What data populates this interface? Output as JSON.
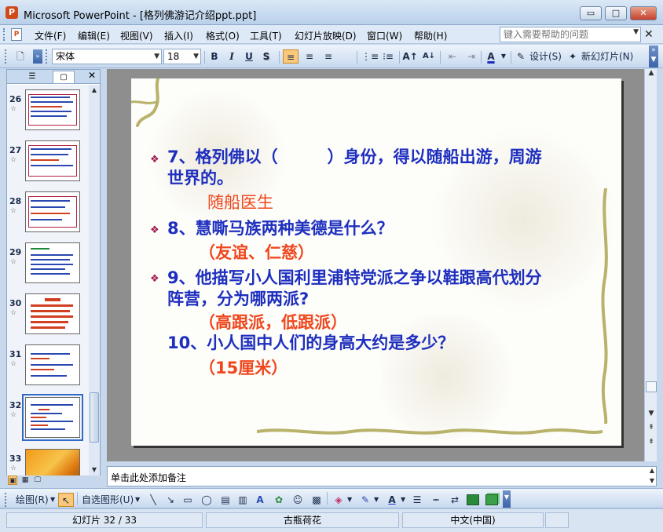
{
  "window": {
    "title": "Microsoft PowerPoint - [格列佛游记介绍ppt.ppt]",
    "app_icon": "powerpoint-icon",
    "buttons": {
      "minimize": "▭",
      "maximize": "□",
      "close": "✕"
    }
  },
  "menu": {
    "items": [
      "文件(F)",
      "编辑(E)",
      "视图(V)",
      "插入(I)",
      "格式(O)",
      "工具(T)",
      "幻灯片放映(D)",
      "窗口(W)",
      "帮助(H)"
    ],
    "help_placeholder": "键入需要帮助的问题"
  },
  "format_toolbar": {
    "font_name": "宋体",
    "font_size": "18",
    "bold": "B",
    "italic": "I",
    "underline": "U",
    "shadow": "S",
    "design_label": "设计(S)",
    "new_slide_label": "新幻灯片(N)"
  },
  "slides_pane": {
    "thumbnails": [
      {
        "num": "26",
        "star": "☆"
      },
      {
        "num": "27",
        "star": "☆"
      },
      {
        "num": "28",
        "star": "☆"
      },
      {
        "num": "29",
        "star": "☆"
      },
      {
        "num": "30",
        "star": "☆"
      },
      {
        "num": "31",
        "star": "☆"
      },
      {
        "num": "32",
        "star": "☆"
      },
      {
        "num": "33",
        "star": "☆"
      }
    ],
    "selected": "32"
  },
  "slide": {
    "q7_line1": "7、格列佛以（　　　）身份，得以随船出游，周游",
    "q7_line2": "世界的。",
    "a7": "随船医生",
    "q8": "8、慧嘶马族两种美德是什么？",
    "a8": "（友谊、仁慈）",
    "q9_line1": "9、他描写小人国利里浦特党派之争以鞋跟高代划分",
    "q9_line2": "阵营，分为哪两派?",
    "a9": "（高跟派，低跟派）",
    "q10": "10、小人国中人们的身高大约是多少？",
    "a10_open": "（",
    "a10_num": "15",
    "a10_close": "厘米）",
    "bullet": "❖"
  },
  "notes": {
    "placeholder": "单击此处添加备注"
  },
  "draw_toolbar": {
    "draw_label": "绘图(R)",
    "autoshape_label": "自选图形(U)"
  },
  "status": {
    "slide_info": "幻灯片 32 / 33",
    "design": "古瓶荷花",
    "language": "中文(中国)"
  },
  "colors": {
    "question": "#1e2fbf",
    "answer": "#f0471e",
    "accent": "#316ac5"
  }
}
